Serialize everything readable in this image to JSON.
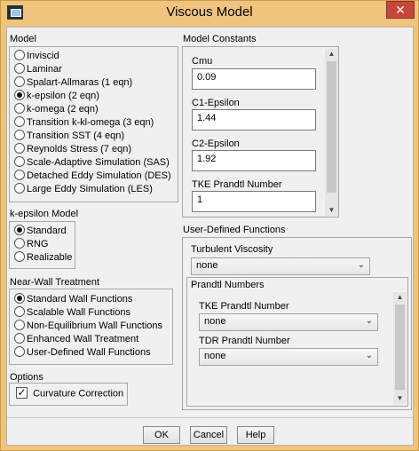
{
  "window": {
    "title": "Viscous Model",
    "close_glyph": "✕"
  },
  "model": {
    "label": "Model",
    "options": [
      {
        "label": "Inviscid",
        "selected": false
      },
      {
        "label": "Laminar",
        "selected": false
      },
      {
        "label": "Spalart-Allmaras (1 eqn)",
        "selected": false
      },
      {
        "label": "k-epsilon (2 eqn)",
        "selected": true
      },
      {
        "label": "k-omega (2 eqn)",
        "selected": false
      },
      {
        "label": "Transition k-kl-omega (3 eqn)",
        "selected": false
      },
      {
        "label": "Transition SST (4 eqn)",
        "selected": false
      },
      {
        "label": "Reynolds Stress (7 eqn)",
        "selected": false
      },
      {
        "label": "Scale-Adaptive Simulation (SAS)",
        "selected": false
      },
      {
        "label": "Detached Eddy Simulation (DES)",
        "selected": false
      },
      {
        "label": "Large Eddy Simulation (LES)",
        "selected": false
      }
    ]
  },
  "k_epsilon_model": {
    "label": "k-epsilon Model",
    "options": [
      {
        "label": "Standard",
        "selected": true
      },
      {
        "label": "RNG",
        "selected": false
      },
      {
        "label": "Realizable",
        "selected": false
      }
    ]
  },
  "near_wall": {
    "label": "Near-Wall Treatment",
    "options": [
      {
        "label": "Standard Wall Functions",
        "selected": true
      },
      {
        "label": "Scalable Wall Functions",
        "selected": false
      },
      {
        "label": "Non-Equilibrium Wall Functions",
        "selected": false
      },
      {
        "label": "Enhanced Wall Treatment",
        "selected": false
      },
      {
        "label": "User-Defined Wall Functions",
        "selected": false
      }
    ]
  },
  "options": {
    "label": "Options",
    "curvature_correction": {
      "label": "Curvature Correction",
      "checked": true,
      "check_glyph": "✓"
    }
  },
  "model_constants": {
    "label": "Model Constants",
    "fields": [
      {
        "label": "Cmu",
        "value": "0.09"
      },
      {
        "label": "C1-Epsilon",
        "value": "1.44"
      },
      {
        "label": "C2-Epsilon",
        "value": "1.92"
      },
      {
        "label": "TKE Prandtl Number",
        "value": "1"
      }
    ]
  },
  "udf": {
    "label": "User-Defined Functions",
    "turbulent_viscosity": {
      "label": "Turbulent Viscosity",
      "value": "none"
    },
    "prandtl_numbers": {
      "label": "Prandtl Numbers",
      "tke": {
        "label": "TKE Prandtl Number",
        "value": "none"
      },
      "tdr": {
        "label": "TDR Prandtl Number",
        "value": "none"
      }
    }
  },
  "buttons": {
    "ok": "OK",
    "cancel": "Cancel",
    "help": "Help"
  },
  "glyphs": {
    "scroll_up": "▲",
    "scroll_down": "▼",
    "chevron": "⌄"
  }
}
